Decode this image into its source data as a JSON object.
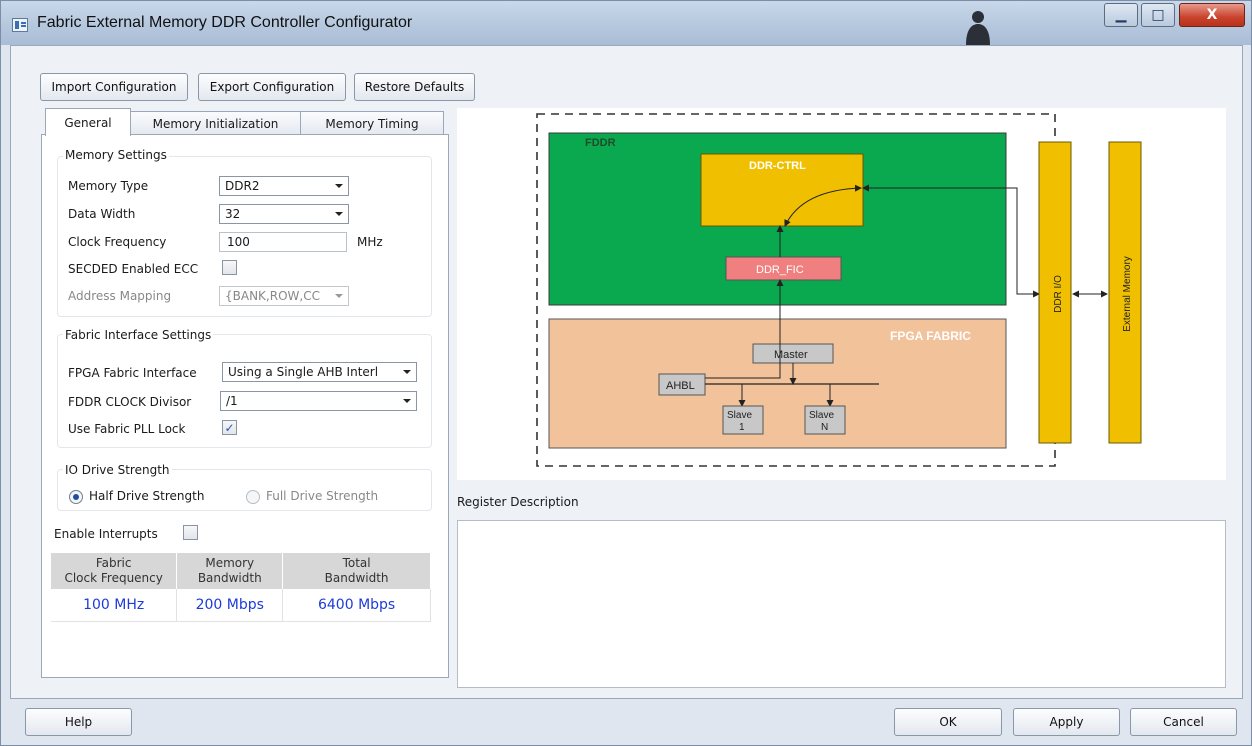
{
  "window": {
    "title": "Fabric External Memory DDR Controller Configurator",
    "minimize": "▁",
    "maximize": "□",
    "close": "X"
  },
  "toolbar": {
    "import": "Import Configuration",
    "export": "Export Configuration",
    "restore": "Restore Defaults"
  },
  "tabs": [
    "General",
    "Memory Initialization",
    "Memory Timing"
  ],
  "memory_settings": {
    "title": "Memory Settings",
    "memory_type_label": "Memory Type",
    "memory_type_value": "DDR2",
    "data_width_label": "Data Width",
    "data_width_value": "32",
    "clock_freq_label": "Clock Frequency",
    "clock_freq_value": "100",
    "clock_freq_unit": "MHz",
    "secded_label": "SECDED Enabled ECC",
    "secded_checked": false,
    "address_mapping_label": "Address Mapping",
    "address_mapping_value": "{BANK,ROW,CC"
  },
  "fabric_interface": {
    "title": "Fabric Interface Settings",
    "fpga_interface_label": "FPGA Fabric Interface",
    "fpga_interface_value": "Using a Single AHB Interl",
    "fddr_divisor_label": "FDDR CLOCK Divisor",
    "fddr_divisor_value": "/1",
    "pll_lock_label": "Use Fabric PLL Lock",
    "pll_lock_checked": true,
    "check_mark": "✓"
  },
  "io_drive": {
    "title": "IO Drive Strength",
    "half_label": "Half Drive Strength",
    "full_label": "Full Drive Strength",
    "selected": "half"
  },
  "interrupts": {
    "label": "Enable Interrupts",
    "checked": false
  },
  "bandwidth_table": {
    "headers": [
      [
        "Fabric",
        "Clock Frequency"
      ],
      [
        "Memory",
        "Bandwidth"
      ],
      [
        "Total",
        "Bandwidth"
      ]
    ],
    "values": [
      "100 MHz",
      "200 Mbps",
      "6400 Mbps"
    ]
  },
  "diagram": {
    "fddr": "FDDR",
    "ddr_ctrl": "DDR-CTRL",
    "ddr_fic": "DDR_FIC",
    "fpga_fabric": "FPGA FABRIC",
    "master": "Master",
    "ahbl": "AHBL",
    "slave1": [
      "Slave",
      "1"
    ],
    "slaveN": [
      "Slave",
      "N"
    ],
    "ddr_io": "DDR I/O",
    "external_memory": "External Memory",
    "colors": {
      "fddr": "#0aa84f",
      "ddr_ctrl": "#f0c000",
      "ddr_fic": "#f08080",
      "fabric": "#f2c29b",
      "io_bar": "#f0c000",
      "slave": "#c8c8c8"
    }
  },
  "register_description": {
    "title": "Register Description"
  },
  "footer": {
    "help": "Help",
    "ok": "OK",
    "apply": "Apply",
    "cancel": "Cancel"
  }
}
